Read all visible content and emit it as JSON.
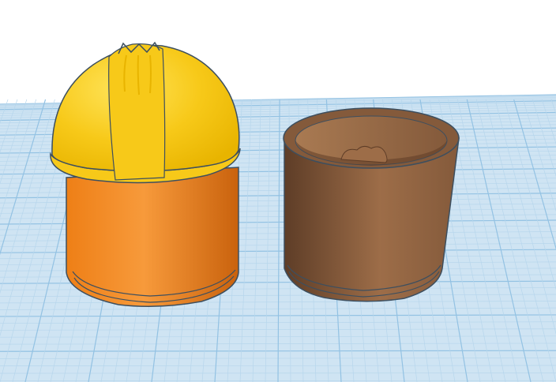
{
  "viewport": {
    "background_color": "#ffffff",
    "workplane": {
      "color": "#cfe4f3",
      "grid_minor_color": "#b7d6ec",
      "grid_major_color": "#93c2e3"
    }
  },
  "objects": [
    {
      "name": "hard-hat-figure",
      "helmet": {
        "color": "#f7c919",
        "shade": "#e8b400",
        "highlight": "#ffe45a"
      },
      "body": {
        "color": "#ee7f16",
        "shade": "#c9620d",
        "highlight": "#f79a3b"
      }
    },
    {
      "name": "brown-cup",
      "color": "#845a3b",
      "shade": "#5e3d27",
      "highlight": "#9d6d48",
      "inner_color": "#a97a52"
    }
  ],
  "outline_color": "#3d4f5f"
}
